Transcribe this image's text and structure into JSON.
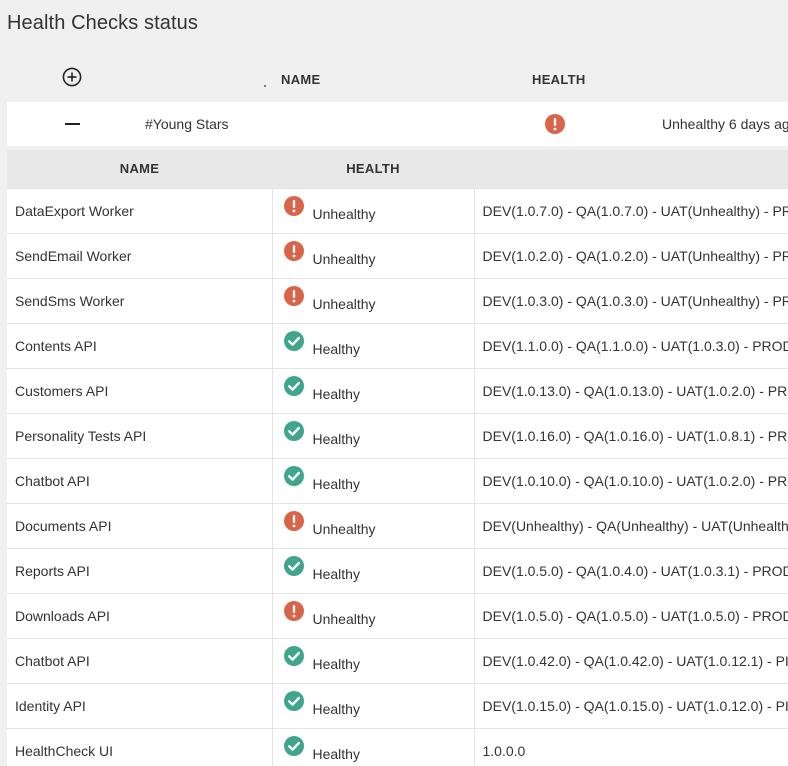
{
  "page": {
    "title": "Health Checks status"
  },
  "header": {
    "name_col": "NAME",
    "health_col": "HEALTH"
  },
  "group": {
    "name": "#Young Stars",
    "status_text": "Unhealthy 6 days ag",
    "status": "unhealthy"
  },
  "sub_table": {
    "columns": [
      "NAME",
      "HEALTH",
      ""
    ],
    "rows": [
      {
        "name": "DataExport Worker",
        "health": "Unhealthy",
        "env": "DEV(1.0.7.0) - QA(1.0.7.0) - UAT(Unhealthy) - PR"
      },
      {
        "name": "SendEmail Worker",
        "health": "Unhealthy",
        "env": "DEV(1.0.2.0) - QA(1.0.2.0) - UAT(Unhealthy) - PR"
      },
      {
        "name": "SendSms Worker",
        "health": "Unhealthy",
        "env": "DEV(1.0.3.0) - QA(1.0.3.0) - UAT(Unhealthy) - PR"
      },
      {
        "name": "Contents API",
        "health": "Healthy",
        "env": "DEV(1.1.0.0) - QA(1.1.0.0) - UAT(1.0.3.0) - PROD"
      },
      {
        "name": "Customers API",
        "health": "Healthy",
        "env": "DEV(1.0.13.0) - QA(1.0.13.0) - UAT(1.0.2.0) - PR"
      },
      {
        "name": "Personality Tests API",
        "health": "Healthy",
        "env": "DEV(1.0.16.0) - QA(1.0.16.0) - UAT(1.0.8.1) - PR"
      },
      {
        "name": "Chatbot API",
        "health": "Healthy",
        "env": "DEV(1.0.10.0) - QA(1.0.10.0) - UAT(1.0.2.0) - PR"
      },
      {
        "name": "Documents API",
        "health": "Unhealthy",
        "env": "DEV(Unhealthy) - QA(Unhealthy) - UAT(Unhealth"
      },
      {
        "name": "Reports API",
        "health": "Healthy",
        "env": "DEV(1.0.5.0) - QA(1.0.4.0) - UAT(1.0.3.1) - PROD"
      },
      {
        "name": "Downloads API",
        "health": "Unhealthy",
        "env": "DEV(1.0.5.0) - QA(1.0.5.0) - UAT(1.0.5.0) - PROD"
      },
      {
        "name": "Chatbot API",
        "health": "Healthy",
        "env": "DEV(1.0.42.0) - QA(1.0.42.0) - UAT(1.0.12.1) - PI"
      },
      {
        "name": "Identity API",
        "health": "Healthy",
        "env": "DEV(1.0.15.0) - QA(1.0.15.0) - UAT(1.0.12.0) - PI"
      },
      {
        "name": "HealthCheck UI",
        "health": "Healthy",
        "env": "1.0.0.0"
      }
    ]
  },
  "colors": {
    "healthy": "#3fa58c",
    "unhealthy": "#d9644a"
  },
  "icons": {
    "expand": "plus-circle-icon",
    "collapse": "minus-icon",
    "healthy": "check-circle-icon",
    "unhealthy": "exclamation-circle-icon"
  }
}
